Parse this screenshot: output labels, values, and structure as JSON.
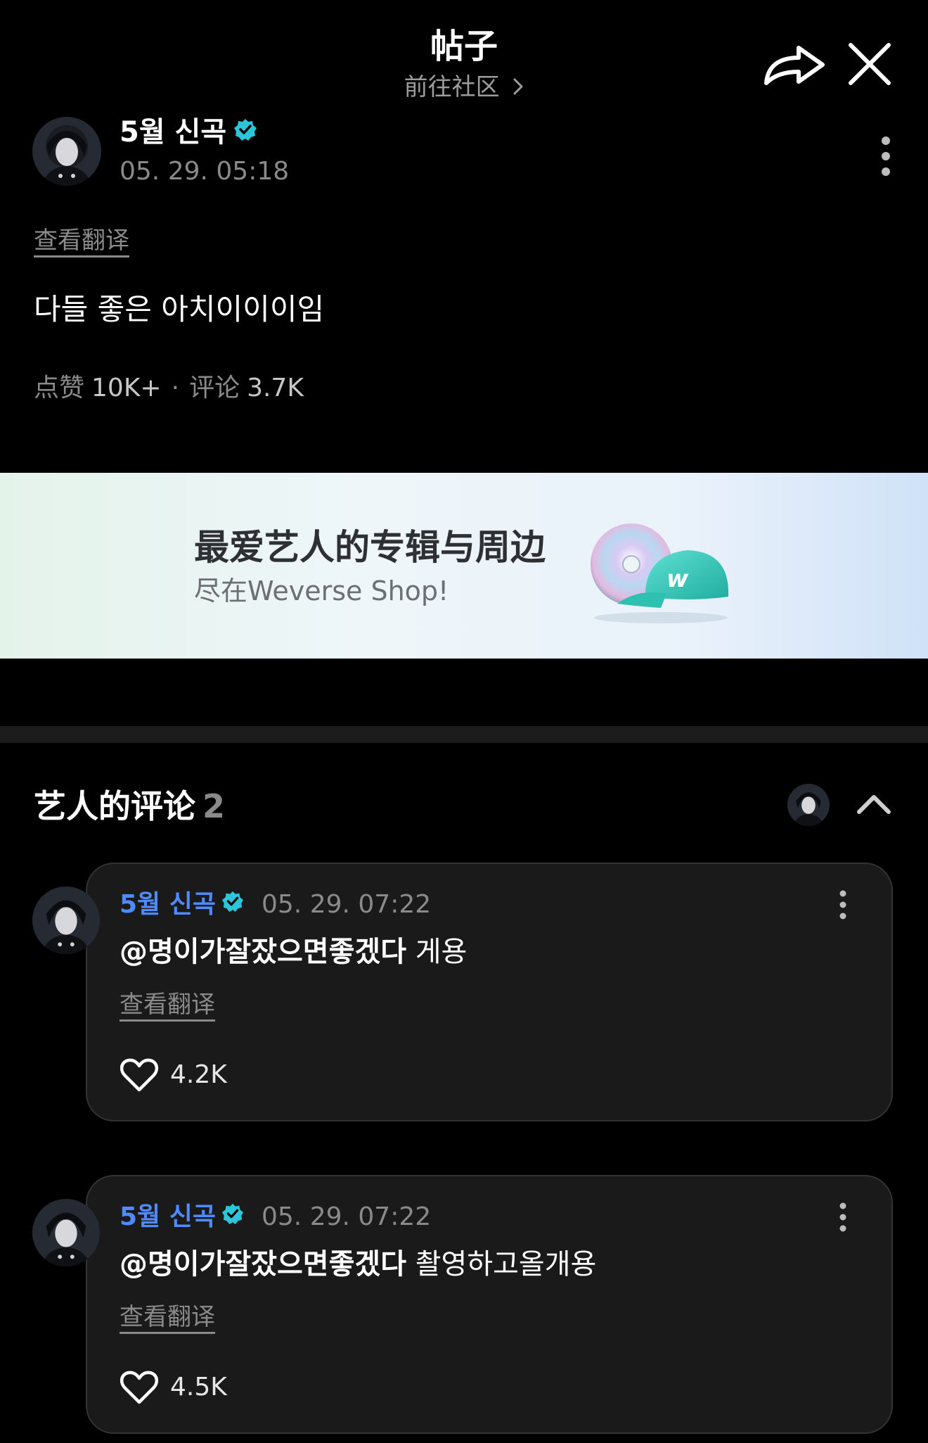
{
  "header": {
    "title": "帖子",
    "subtitle": "前往社区"
  },
  "post": {
    "author": "5월 신곡",
    "time": "05. 29. 05:18",
    "translate_label": "查看翻译",
    "text": "다들 좋은 아치이이이임",
    "likes_label": "点赞",
    "likes_value": "10K+",
    "separator": "·",
    "comments_label": "评论",
    "comments_value": "3.7K"
  },
  "banner": {
    "title": "最爱艺人的专辑与周边",
    "subtitle": "尽在Weverse Shop!"
  },
  "artist_comments": {
    "title": "艺人的评论",
    "count": "2",
    "items": [
      {
        "author": "5월 신곡",
        "time": "05. 29. 07:22",
        "mention": "@명이가잘잤으면좋겠다",
        "text": "게용",
        "translate_label": "查看翻译",
        "likes": "4.2K"
      },
      {
        "author": "5월 신곡",
        "time": "05. 29. 07:22",
        "mention": "@명이가잘잤으면좋겠다",
        "text": "촬영하고올개용",
        "translate_label": "查看翻译",
        "likes": "4.5K"
      }
    ]
  },
  "colors": {
    "background": "#000000",
    "accent_blue": "#4f8bff",
    "verified_teal": "#2bc6d9",
    "card_bg": "#1a1a1a"
  }
}
